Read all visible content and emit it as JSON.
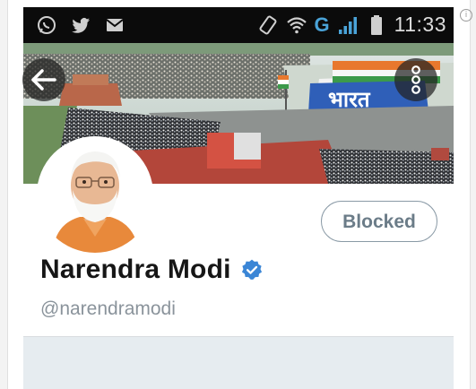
{
  "status_bar": {
    "left_icons": [
      "whatsapp-icon",
      "twitter-icon",
      "mail-icon"
    ],
    "right_icons": [
      "rotate-icon",
      "wifi-icon",
      "signal-icon",
      "battery-icon"
    ],
    "network": "G",
    "time": "11:33"
  },
  "header": {
    "back_icon": "arrow-left-icon",
    "more_icon": "more-vertical-icon"
  },
  "profile": {
    "name": "Narendra Modi",
    "handle": "@narendramodi",
    "verified_icon": "verified-badge-icon",
    "action_button": "Blocked",
    "banner_text": "भारत"
  },
  "colors": {
    "status_bar": "#0b0b0b",
    "verified": "#3b86d6",
    "button_border": "#8a9aa6",
    "panel": "#e6ecf0"
  }
}
